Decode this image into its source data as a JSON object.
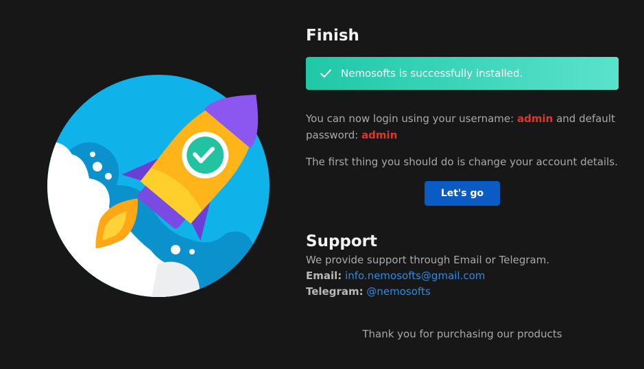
{
  "finish": {
    "title": "Finish",
    "alert_text": "Nemosofts is successfully installed.",
    "login_prefix": "You can now login using your username:",
    "username": "admin",
    "login_middle": "and default password:",
    "password": "admin",
    "change_text": "The first thing you should do is change your account details.",
    "button_label": "Let's go"
  },
  "support": {
    "title": "Support",
    "intro": "We provide support through Email or Telegram.",
    "email_label": "Email:",
    "email_value": "info.nemosofts@gmail.com",
    "telegram_label": "Telegram:",
    "telegram_value": "@nemosofts"
  },
  "footer": {
    "thanks": "Thank you for purchasing our products"
  },
  "colors": {
    "background": "#171717",
    "alert_start": "#1fc8a7",
    "alert_end": "#5ae2cc",
    "button": "#0a5bc4",
    "credential": "#e0362b",
    "link": "#2a8be8"
  },
  "icons": {
    "alert_icon": "check-icon",
    "illustration": "rocket-launch-illustration"
  }
}
